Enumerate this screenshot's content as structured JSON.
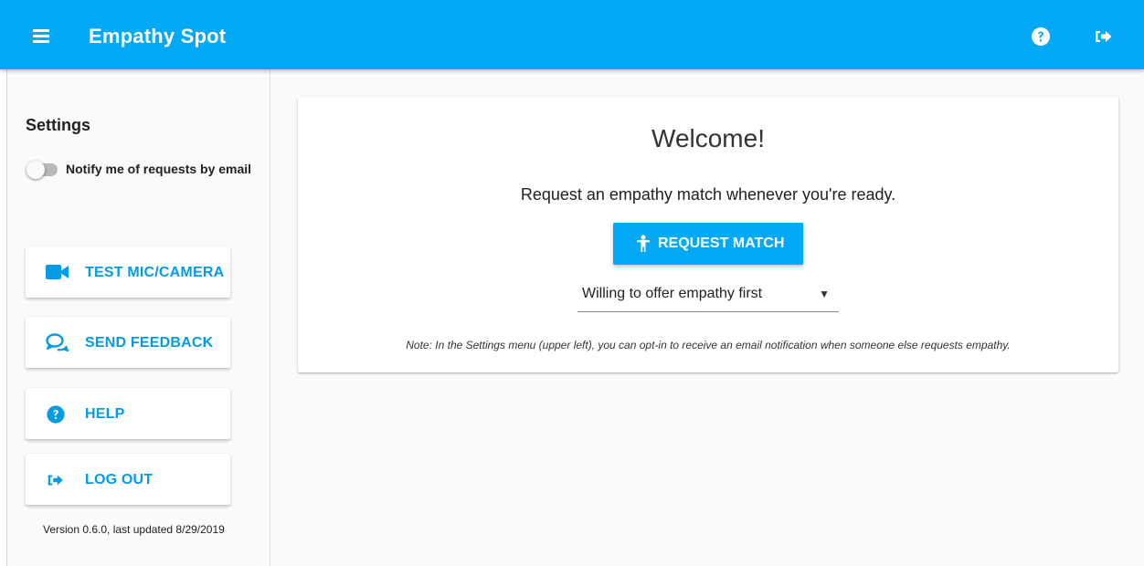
{
  "appbar": {
    "title": "Empathy Spot",
    "menu_icon": "menu-icon",
    "help_icon": "help-circle-icon",
    "logout_icon": "logout-icon",
    "color": "#03a9f4"
  },
  "sidebar": {
    "settings_title": "Settings",
    "notify_label": "Notify me of requests by email",
    "notify_enabled": false,
    "buttons": [
      {
        "label": "TEST MIC/CAMERA",
        "icon": "video-camera-icon"
      },
      {
        "label": "SEND FEEDBACK",
        "icon": "chat-bubbles-icon"
      },
      {
        "label": "HELP",
        "icon": "help-circle-icon"
      },
      {
        "label": "LOG OUT",
        "icon": "logout-icon"
      }
    ],
    "version": "Version 0.6.0, last updated 8/29/2019"
  },
  "main": {
    "heading": "Welcome!",
    "subtitle": "Request an empathy match whenever you're ready.",
    "request_button": {
      "label": "REQUEST MATCH",
      "icon": "person-icon"
    },
    "mode_select": {
      "value": "Willing to offer empathy first"
    },
    "note": "Note: In the Settings menu (upper left), you can opt-in to receive an email notification when someone else requests empathy."
  },
  "colors": {
    "accent": "#03a9f4",
    "accent_text": "#039be5",
    "background": "#fafafa"
  }
}
